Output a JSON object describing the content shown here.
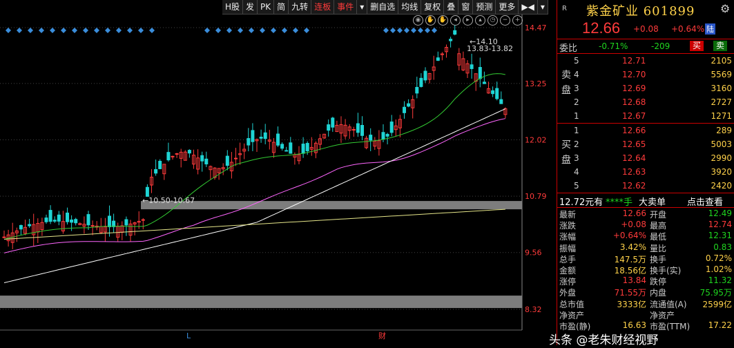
{
  "toolbar": [
    "H股",
    "发",
    "PK",
    "简",
    "九转",
    "连板",
    "事件",
    "▾",
    "删自选",
    "均线",
    "复权",
    "叠",
    "窗",
    "预测",
    "更多",
    "▶◀",
    "▾"
  ],
  "axis": {
    "ticks": [
      "14.47",
      "13.25",
      "12.02",
      "10.79",
      "9.56",
      "8.32"
    ],
    "bottom_marks": [
      "L",
      "财"
    ]
  },
  "annotations": {
    "high": "14.10",
    "range1": "13.83-13.82",
    "range2": "10.50-10.67"
  },
  "header": {
    "r": "R",
    "name": "紫金矿业 601899",
    "gear": "⚙"
  },
  "price": {
    "last": "12.66",
    "change": "+0.08",
    "pct": "+0.64%",
    "tag": "陆"
  },
  "weibi": {
    "label": "委比",
    "ratio": "-0.71%",
    "diff": "-209",
    "buy_btn": "买",
    "sell_btn": "卖"
  },
  "orderbook": {
    "sell_label": "卖\n盘",
    "buy_label": "买\n盘",
    "sell": [
      {
        "lvl": "5",
        "price": "12.71",
        "vol": "2105"
      },
      {
        "lvl": "4",
        "price": "12.70",
        "vol": "5569"
      },
      {
        "lvl": "3",
        "price": "12.69",
        "vol": "3160"
      },
      {
        "lvl": "2",
        "price": "12.68",
        "vol": "2727"
      },
      {
        "lvl": "1",
        "price": "12.67",
        "vol": "1271"
      }
    ],
    "buy": [
      {
        "lvl": "1",
        "price": "12.66",
        "vol": "289"
      },
      {
        "lvl": "2",
        "price": "12.65",
        "vol": "5003"
      },
      {
        "lvl": "3",
        "price": "12.64",
        "vol": "2990"
      },
      {
        "lvl": "4",
        "price": "12.63",
        "vol": "3920"
      },
      {
        "lvl": "5",
        "price": "12.62",
        "vol": "2420"
      }
    ]
  },
  "info_head": {
    "a": "12.72元有",
    "b": "****手",
    "c": "大卖单",
    "d": "点击查看"
  },
  "stats": [
    {
      "l1": "最新",
      "v1": "12.66",
      "c1": "red",
      "l2": "开盘",
      "v2": "12.49",
      "c2": "grn"
    },
    {
      "l1": "涨跌",
      "v1": "+0.08",
      "c1": "red",
      "l2": "最高",
      "v2": "12.74",
      "c2": "red"
    },
    {
      "l1": "涨幅",
      "v1": "+0.64%",
      "c1": "red",
      "l2": "最低",
      "v2": "12.31",
      "c2": "grn"
    },
    {
      "l1": "振幅",
      "v1": "3.42%",
      "c1": "yel",
      "l2": "量比",
      "v2": "0.83",
      "c2": "grn"
    },
    {
      "l1": "总手",
      "v1": "147.5万",
      "c1": "yel",
      "l2": "换手",
      "v2": "0.72%",
      "c2": "yel"
    },
    {
      "l1": "金额",
      "v1": "18.56亿",
      "c1": "yel",
      "l2": "换手(实)",
      "v2": "1.02%",
      "c2": "yel"
    },
    {
      "l1": "涨停",
      "v1": "13.84",
      "c1": "red",
      "l2": "跌停",
      "v2": "11.32",
      "c2": "grn"
    },
    {
      "l1": "外盘",
      "v1": "71.55万",
      "c1": "red",
      "l2": "内盘",
      "v2": "75.95万",
      "c2": "grn"
    },
    {
      "l1": "总市值",
      "v1": "3333亿",
      "c1": "yel",
      "l2": "流通值(A)",
      "v2": "2599亿",
      "c2": "yel"
    },
    {
      "l1": "净资产",
      "v1": "",
      "c1": "yel",
      "l2": "净资产",
      "v2": "",
      "c2": "yel"
    },
    {
      "l1": "市盈(静)",
      "v1": "16.63",
      "c1": "yel",
      "l2": "市盈(TTM)",
      "v2": "17.22",
      "c2": "yel"
    }
  ],
  "watermark": "头条 @老朱财经视野",
  "colors": {
    "up": "#ff3b3b",
    "down": "#1fd4d4",
    "ma5": "#ffffff",
    "ma20": "#33cc33",
    "ma60": "#ff66ff",
    "ma120": "#ffffff",
    "ma250": "#e6e68a"
  }
}
